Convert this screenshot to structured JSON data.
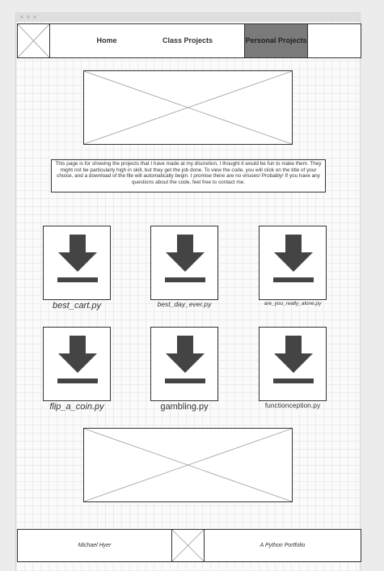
{
  "nav": {
    "items": [
      {
        "label": "Home"
      },
      {
        "label": "Class Projects"
      },
      {
        "label": "Personal Projects",
        "active": true
      }
    ]
  },
  "intro": {
    "text": "This page is for showing the projects that I have made at my discretion. I thought it would be fun to make them. They might not be particularly high in skill, but they get the job done. To view the code, you will click on the title of your choice, and a download of the file will automatically begin. I promise there are no viruses! Probably! If you have any questions about the code, feel free to contact me."
  },
  "files": [
    {
      "name": "best_cart.py",
      "icon": "download-icon"
    },
    {
      "name": "best_day_ever.py",
      "icon": "download-icon"
    },
    {
      "name": "are_you_really_alone.py",
      "icon": "download-icon"
    },
    {
      "name": "flip_a_coin.py",
      "icon": "download-icon"
    },
    {
      "name": "gambling.py",
      "icon": "download-icon"
    },
    {
      "name": "functionception.py",
      "icon": "download-icon"
    }
  ],
  "footer": {
    "author": "Michael Hyer",
    "tagline": "A Python Portfolio"
  },
  "colors": {
    "active_nav_bg": "#7a7a7a",
    "icon_fill": "#444444",
    "border": "#333333"
  }
}
